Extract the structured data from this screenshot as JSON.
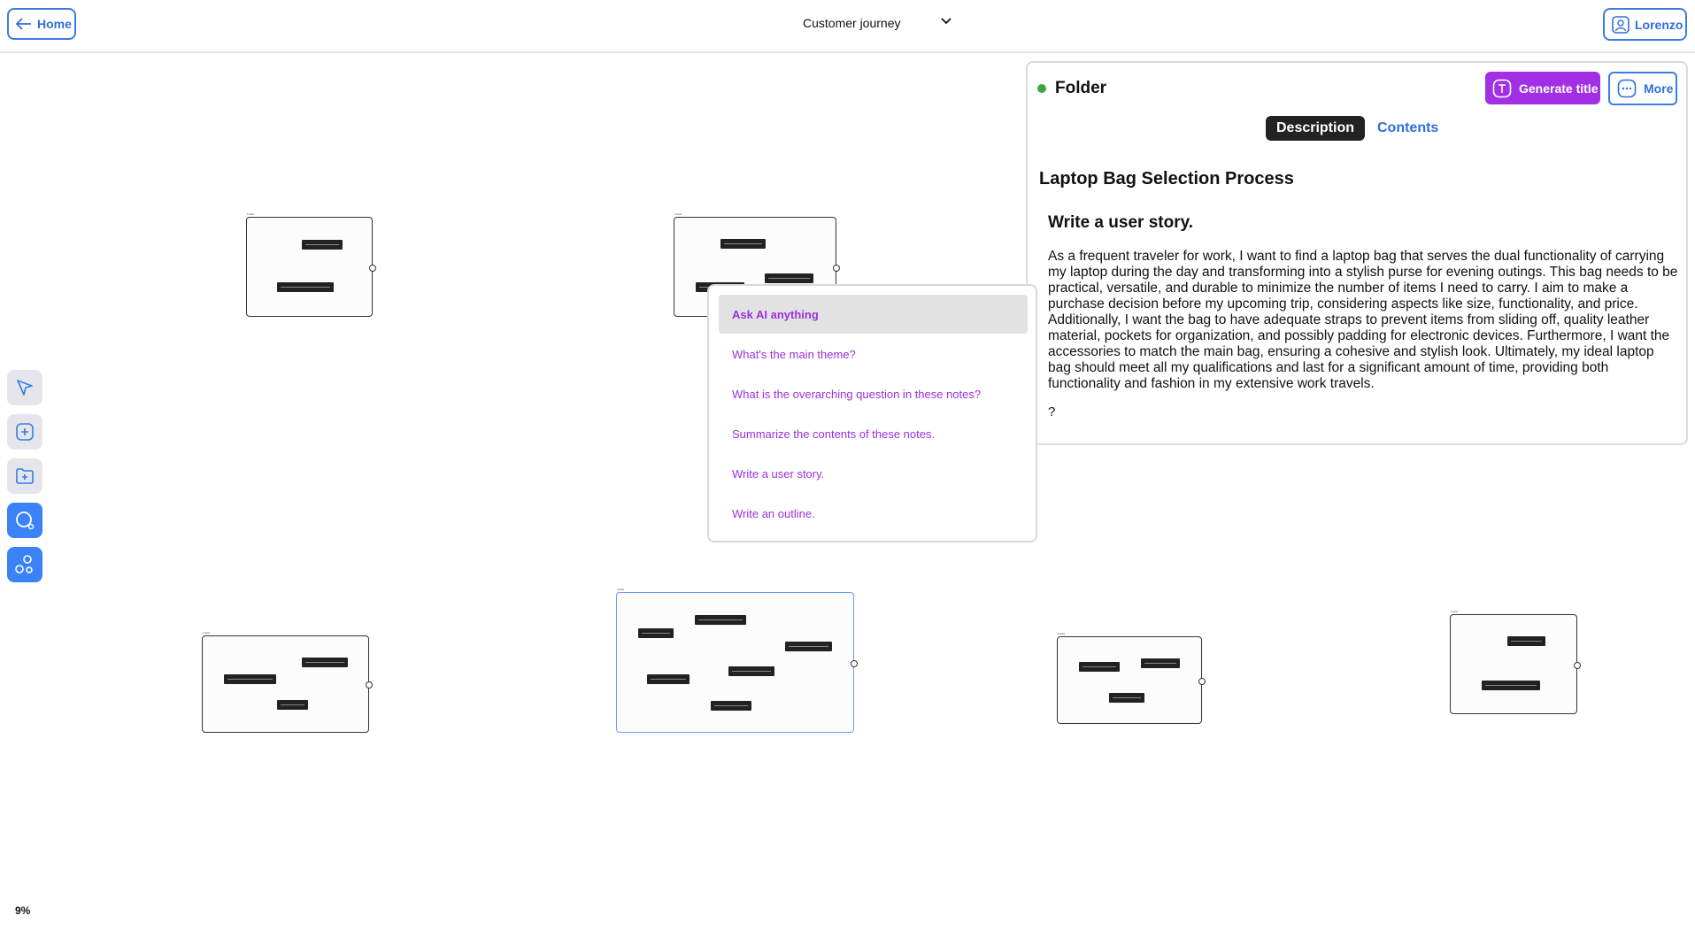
{
  "header": {
    "home_label": "Home",
    "doc_title": "Customer journey",
    "user_name": "Lorenzo"
  },
  "toolbar": {
    "tools": [
      "pointer-icon",
      "add-note-icon",
      "add-folder-icon",
      "search-icon",
      "ai-network-icon"
    ],
    "zoom_label": "9%"
  },
  "ai_menu": {
    "items": [
      "Ask AI anything",
      "What's the main theme?",
      "What is the overarching question in these notes?",
      "Summarize the contents of these notes.",
      "Write a user story.",
      "Write an outline."
    ]
  },
  "panel": {
    "type_label": "Folder",
    "generate_label": "Generate title",
    "more_label": "More",
    "tabs": {
      "description": "Description",
      "contents": "Contents"
    },
    "title": "Laptop Bag Selection Process",
    "heading": "Write a user story.",
    "body": "As a frequent traveler for work, I want to find a laptop bag that serves the dual functionality of carrying my laptop during the day and transforming into a stylish purse for evening outings. This bag needs to be practical, versatile, and durable to minimize the number of items I need to carry. I aim to make a purchase decision before my upcoming trip, considering aspects like size, functionality, and price. Additionally, I want the bag to have adequate straps to prevent items from sliding off, quality leather material, pockets for organization, and possibly padding for electronic devices. Furthermore, I want the accessories to match the main bag, ensuring a cohesive and stylish look. Ultimately, my ideal laptop bag should meet all my qualifications and last for a significant amount of time, providing both functionality and fashion in my extensive work travels.",
    "trailing": "?",
    "status_color": "#39a845",
    "accent_color": "#a22fe6",
    "link_color": "#2f6fdc"
  }
}
